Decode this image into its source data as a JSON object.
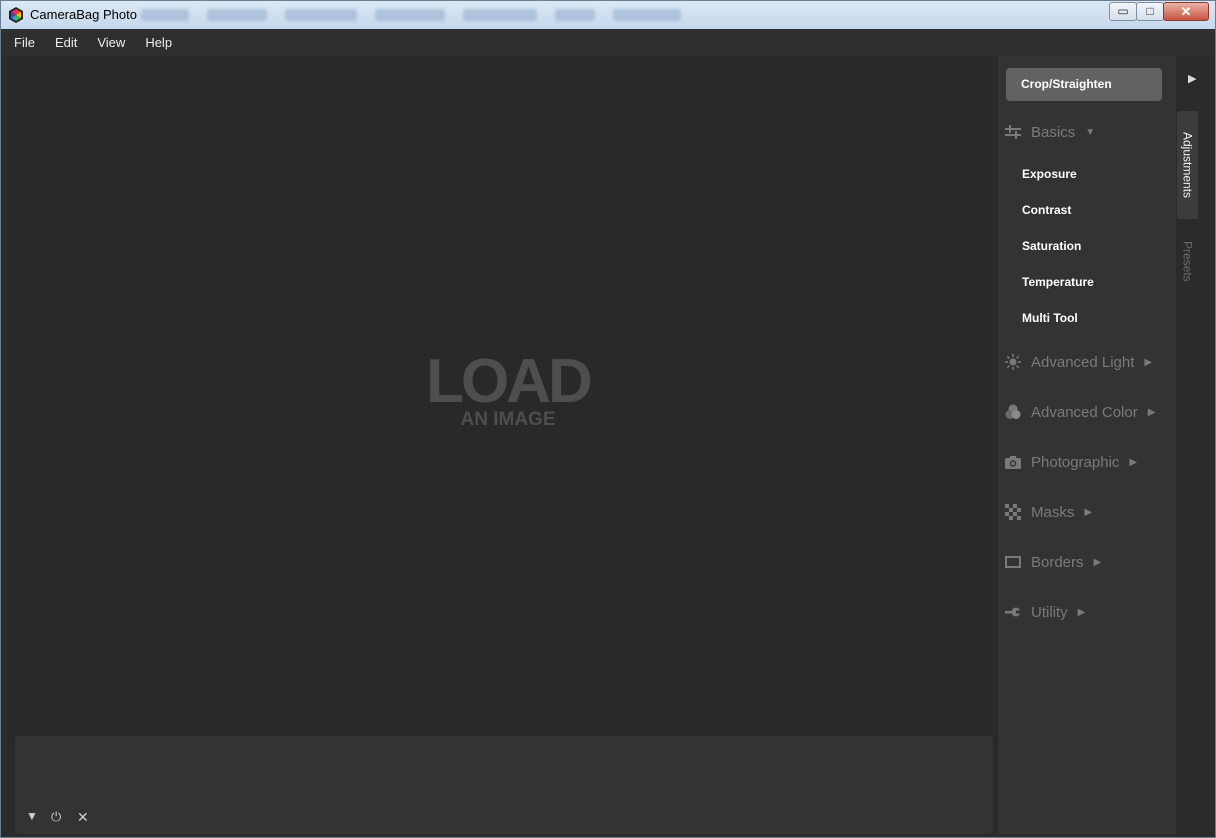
{
  "window": {
    "title": "CameraBag Photo",
    "controls": {
      "minimize": "▭",
      "maximize": "□",
      "close": "✕"
    }
  },
  "menu": [
    "File",
    "Edit",
    "View",
    "Help"
  ],
  "canvas": {
    "placeholder_big": "LOAD",
    "placeholder_small": "AN IMAGE"
  },
  "strip_controls": {
    "collapse": "▼",
    "power": "⏻",
    "clear": "✕"
  },
  "panel": {
    "crop_label": "Crop/Straighten",
    "basics": {
      "label": "Basics",
      "icon": "sliders-icon",
      "expanded": true,
      "items": [
        "Exposure",
        "Contrast",
        "Saturation",
        "Temperature",
        "Multi Tool"
      ]
    },
    "sections": [
      {
        "label": "Advanced Light",
        "icon": "sun-icon"
      },
      {
        "label": "Advanced Color",
        "icon": "color-circles-icon"
      },
      {
        "label": "Photographic",
        "icon": "camera-icon"
      },
      {
        "label": "Masks",
        "icon": "checker-icon"
      },
      {
        "label": "Borders",
        "icon": "frame-icon"
      },
      {
        "label": "Utility",
        "icon": "wrench-icon"
      }
    ]
  },
  "side_tabs": {
    "expand_icon": "▶",
    "active": "Adjustments",
    "inactive": "Presets"
  },
  "colors": {
    "canvas_bg": "#292929",
    "panel_bg": "#333333",
    "crop_button_bg": "#626262",
    "placeholder_text": "#4e4e4e"
  }
}
